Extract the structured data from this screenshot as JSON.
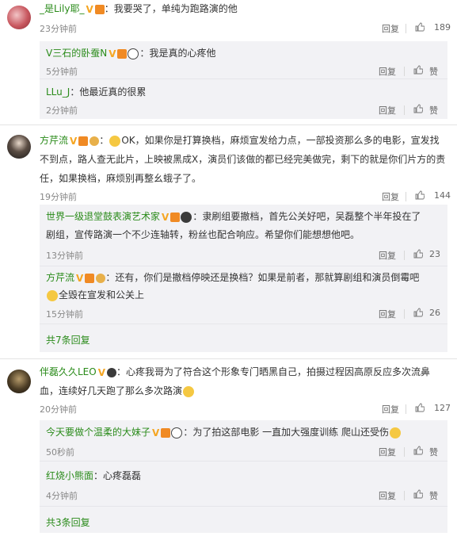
{
  "comments": [
    {
      "author": "_是Lily耶_",
      "text": "：我要哭了，单纯为跑路演的他",
      "time": "23分钟前",
      "reply_label": "回复",
      "likes": "189"
    },
    {
      "author": "方芹流",
      "text_line1": "OK，如果你是打算换档，麻烦宣发给力点，一部投资那么多的电影，宣发找",
      "text_line2": "不到点，路人查无此片，上映被黑成X，演员们该做的都已经完美做完，剩下的就是你们片方的责",
      "text_line3": "任，如果换档，麻烦别再整幺蛾子了。",
      "time": "19分钟前",
      "reply_label": "回复",
      "likes": "144"
    },
    {
      "author": "伴磊久久LEO",
      "text_line1": "：心疼我哥为了符合这个形象专门晒黑自己，拍摄过程因高原反应多次流鼻",
      "text_line2": "血，连续好几天跑了那么多次路演",
      "time": "20分钟前",
      "reply_label": "回复",
      "likes": "127"
    }
  ],
  "replies_a": [
    {
      "author": "V三石的卧蚕N",
      "text": "：我是真的心疼他",
      "time": "5分钟前",
      "reply_label": "回复",
      "likes_label": "赞"
    },
    {
      "author": "LLu_J",
      "text": "：他最近真的很累",
      "time": "2分钟前",
      "reply_label": "回复",
      "likes_label": "赞"
    }
  ],
  "replies_b": [
    {
      "author": "世界一级退堂鼓表演艺术家",
      "text_line1": "：隶刷组要撤档，首先公关好吧，吴磊整个半年投在了",
      "text_line2": "剧组，宣传路演一个不少连轴转，粉丝也配合响应。希望你们能想想他吧。",
      "time": "13分钟前",
      "reply_label": "回复",
      "likes": "23"
    },
    {
      "author": "方芹流",
      "text_line1": "：还有，你们是撤档停映还是换档？如果是前者，那就算剧组和演员倒霉吧",
      "text_line2": "全毁在宣发和公关上",
      "time": "15分钟前",
      "reply_label": "回复",
      "likes": "26"
    }
  ],
  "more_b": "共7条回复",
  "replies_c": [
    {
      "author": "今天要做个温柔的大妹子",
      "text": "：为了拍这部电影 一直加大强度训练 爬山还受伤",
      "time": "50秒前",
      "reply_label": "回复",
      "likes_label": "赞"
    },
    {
      "author": "红烧小熊面",
      "text": "：心疼磊磊",
      "time": "4分钟前",
      "reply_label": "回复",
      "likes_label": "赞"
    }
  ],
  "more_c": "共3条回复",
  "colors": {
    "name_green": "#2a8b1a",
    "badge_gold": "#f5a623",
    "reply_bg": "#f2f2f5"
  }
}
